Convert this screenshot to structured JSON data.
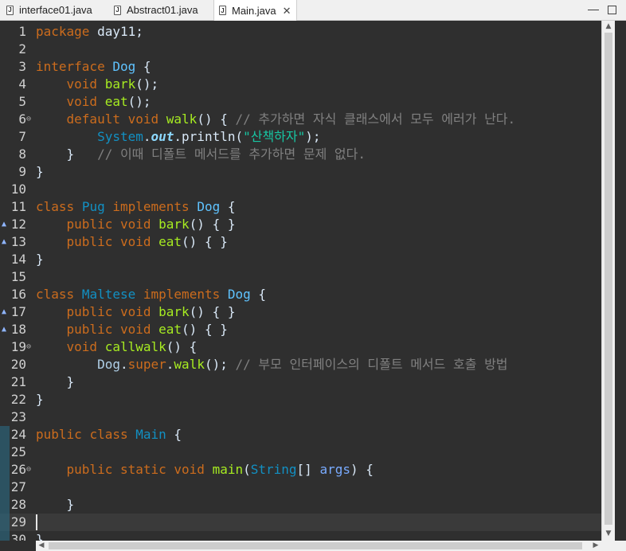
{
  "tabs": [
    {
      "label": "interface01.java",
      "icon": "java-file-icon",
      "active": false
    },
    {
      "label": "Abstract01.java",
      "icon": "java-file-icon",
      "active": false
    },
    {
      "label": "Main.java",
      "icon": "java-file-icon",
      "active": true
    }
  ],
  "window": {
    "minimize": "—",
    "maximize": "□"
  },
  "editor": {
    "current_line": 29,
    "lines": [
      {
        "n": "1",
        "tokens": [
          [
            "kw",
            "package"
          ],
          [
            "plain",
            " day11;"
          ]
        ]
      },
      {
        "n": "2",
        "tokens": []
      },
      {
        "n": "3",
        "tokens": [
          [
            "kw",
            "interface"
          ],
          [
            "plain",
            " "
          ],
          [
            "cls",
            "Dog"
          ],
          [
            "plain",
            " {"
          ]
        ]
      },
      {
        "n": "4",
        "tokens": [
          [
            "plain",
            "    "
          ],
          [
            "kw",
            "void"
          ],
          [
            "plain",
            " "
          ],
          [
            "method",
            "bark"
          ],
          [
            "plain",
            "();"
          ]
        ]
      },
      {
        "n": "5",
        "tokens": [
          [
            "plain",
            "    "
          ],
          [
            "kw",
            "void"
          ],
          [
            "plain",
            " "
          ],
          [
            "method",
            "eat"
          ],
          [
            "plain",
            "();"
          ]
        ]
      },
      {
        "n": "6",
        "marker": "fold",
        "tokens": [
          [
            "plain",
            "    "
          ],
          [
            "kw",
            "default"
          ],
          [
            "plain",
            " "
          ],
          [
            "kw",
            "void"
          ],
          [
            "plain",
            " "
          ],
          [
            "method",
            "walk"
          ],
          [
            "plain",
            "() { "
          ],
          [
            "cmt",
            "// 추가하면 자식 클래스에서 모두 에러가 난다."
          ]
        ]
      },
      {
        "n": "7",
        "tokens": [
          [
            "plain",
            "        "
          ],
          [
            "type",
            "System"
          ],
          [
            "plain",
            "."
          ],
          [
            "field",
            "out"
          ],
          [
            "plain",
            ".println("
          ],
          [
            "str",
            "\"산책하자\""
          ],
          [
            "plain",
            ");"
          ]
        ]
      },
      {
        "n": "8",
        "tokens": [
          [
            "plain",
            "    }   "
          ],
          [
            "cmt",
            "// 이때 디폴트 메서드를 추가하면 문제 없다."
          ]
        ]
      },
      {
        "n": "9",
        "tokens": [
          [
            "plain",
            "}"
          ]
        ]
      },
      {
        "n": "10",
        "tokens": []
      },
      {
        "n": "11",
        "tokens": [
          [
            "kw",
            "class"
          ],
          [
            "plain",
            " "
          ],
          [
            "type",
            "Pug"
          ],
          [
            "plain",
            " "
          ],
          [
            "kw",
            "implements"
          ],
          [
            "plain",
            " "
          ],
          [
            "cls",
            "Dog"
          ],
          [
            "plain",
            " {"
          ]
        ]
      },
      {
        "n": "12",
        "marker": "override",
        "tokens": [
          [
            "plain",
            "    "
          ],
          [
            "kw",
            "public"
          ],
          [
            "plain",
            " "
          ],
          [
            "kw",
            "void"
          ],
          [
            "plain",
            " "
          ],
          [
            "method",
            "bark"
          ],
          [
            "plain",
            "() { }"
          ]
        ]
      },
      {
        "n": "13",
        "marker": "override",
        "tokens": [
          [
            "plain",
            "    "
          ],
          [
            "kw",
            "public"
          ],
          [
            "plain",
            " "
          ],
          [
            "kw",
            "void"
          ],
          [
            "plain",
            " "
          ],
          [
            "method",
            "eat"
          ],
          [
            "plain",
            "() { }"
          ]
        ]
      },
      {
        "n": "14",
        "tokens": [
          [
            "plain",
            "}"
          ]
        ]
      },
      {
        "n": "15",
        "tokens": []
      },
      {
        "n": "16",
        "tokens": [
          [
            "kw",
            "class"
          ],
          [
            "plain",
            " "
          ],
          [
            "type",
            "Maltese"
          ],
          [
            "plain",
            " "
          ],
          [
            "kw",
            "implements"
          ],
          [
            "plain",
            " "
          ],
          [
            "cls",
            "Dog"
          ],
          [
            "plain",
            " {"
          ]
        ]
      },
      {
        "n": "17",
        "marker": "override",
        "tokens": [
          [
            "plain",
            "    "
          ],
          [
            "kw",
            "public"
          ],
          [
            "plain",
            " "
          ],
          [
            "kw",
            "void"
          ],
          [
            "plain",
            " "
          ],
          [
            "method",
            "bark"
          ],
          [
            "plain",
            "() { }"
          ]
        ]
      },
      {
        "n": "18",
        "marker": "override",
        "tokens": [
          [
            "plain",
            "    "
          ],
          [
            "kw",
            "public"
          ],
          [
            "plain",
            " "
          ],
          [
            "kw",
            "void"
          ],
          [
            "plain",
            " "
          ],
          [
            "method",
            "eat"
          ],
          [
            "plain",
            "() { }"
          ]
        ]
      },
      {
        "n": "19",
        "marker": "fold",
        "tokens": [
          [
            "plain",
            "    "
          ],
          [
            "kw",
            "void"
          ],
          [
            "plain",
            " "
          ],
          [
            "method",
            "callwalk"
          ],
          [
            "plain",
            "() {"
          ]
        ]
      },
      {
        "n": "20",
        "tokens": [
          [
            "plain",
            "        "
          ],
          [
            "obj",
            "Dog"
          ],
          [
            "plain",
            "."
          ],
          [
            "kw",
            "super"
          ],
          [
            "plain",
            "."
          ],
          [
            "method",
            "walk"
          ],
          [
            "plain",
            "(); "
          ],
          [
            "cmt",
            "// 부모 인터페이스의 디폴트 메서드 호출 방법"
          ]
        ]
      },
      {
        "n": "21",
        "tokens": [
          [
            "plain",
            "    }"
          ]
        ]
      },
      {
        "n": "22",
        "tokens": [
          [
            "plain",
            "}"
          ]
        ]
      },
      {
        "n": "23",
        "tokens": []
      },
      {
        "n": "24",
        "tokens": [
          [
            "kw",
            "public"
          ],
          [
            "plain",
            " "
          ],
          [
            "kw",
            "class"
          ],
          [
            "plain",
            " "
          ],
          [
            "type",
            "Main"
          ],
          [
            "plain",
            " {"
          ]
        ]
      },
      {
        "n": "25",
        "tokens": []
      },
      {
        "n": "26",
        "marker": "fold",
        "tokens": [
          [
            "plain",
            "    "
          ],
          [
            "kw",
            "public"
          ],
          [
            "plain",
            " "
          ],
          [
            "kw",
            "static"
          ],
          [
            "plain",
            " "
          ],
          [
            "kw",
            "void"
          ],
          [
            "plain",
            " "
          ],
          [
            "method",
            "main"
          ],
          [
            "plain",
            "("
          ],
          [
            "type",
            "String"
          ],
          [
            "plain",
            "[] "
          ],
          [
            "param",
            "args"
          ],
          [
            "plain",
            ") {"
          ]
        ]
      },
      {
        "n": "27",
        "tokens": []
      },
      {
        "n": "28",
        "tokens": [
          [
            "plain",
            "    }"
          ]
        ]
      },
      {
        "n": "29",
        "tokens": []
      },
      {
        "n": "30",
        "tokens": [
          [
            "plain",
            "}"
          ]
        ]
      }
    ],
    "overview_lines_from": 24
  },
  "scroll": {
    "up": "▲",
    "down": "▼",
    "left": "◀",
    "right": "▶"
  }
}
